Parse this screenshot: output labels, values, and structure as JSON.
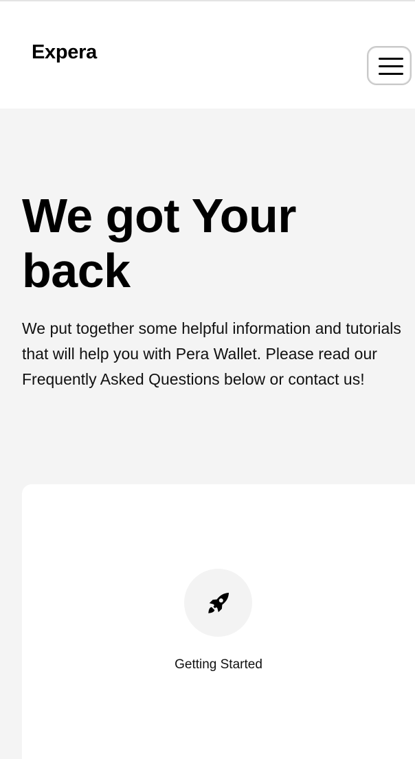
{
  "header": {
    "logo": "Expera",
    "menu_icon": "hamburger-menu-icon"
  },
  "hero": {
    "title": "We got Your back",
    "description": "We put together some helpful information and tutorials that will help you with Pera Wallet. Please read our Frequently Asked Questions below or contact us!"
  },
  "cards": [
    {
      "icon": "rocket-icon",
      "label": "Getting Started"
    }
  ]
}
